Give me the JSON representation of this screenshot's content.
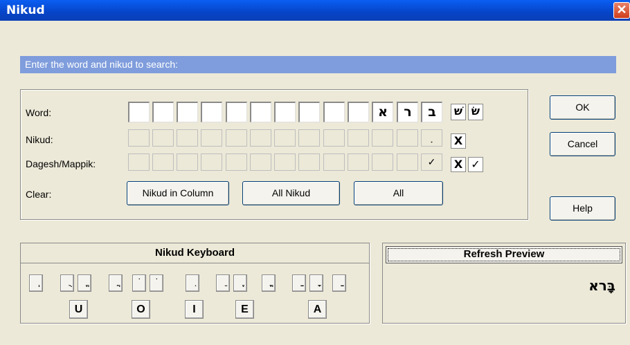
{
  "window": {
    "title": "Nikud",
    "close_glyph": "✕"
  },
  "banner": {
    "text": "Enter the word and nikud to search:"
  },
  "labels": {
    "word": "Word:",
    "nikud": "Nikud:",
    "dagesh": "Dagesh/Mappik:",
    "clear": "Clear:"
  },
  "word_letters": [
    "",
    "",
    "",
    "",
    "",
    "",
    "",
    "",
    "",
    "",
    "א",
    "ר",
    "ב"
  ],
  "nikud_marks": [
    "",
    "",
    "",
    "",
    "",
    "",
    "",
    "",
    "",
    "",
    "",
    "",
    "ָ"
  ],
  "dagesh_marks": [
    "",
    "",
    "",
    "",
    "",
    "",
    "",
    "",
    "",
    "",
    "",
    "",
    "✓"
  ],
  "side_controls": {
    "shin_right": "שׁ",
    "shin_left": "שׂ",
    "clear_nikud": "X",
    "clear_dagesh": "X",
    "dagesh_check": "✓"
  },
  "clear_buttons": {
    "nikud_in_column": "Nikud in Column",
    "all_nikud": "All Nikud",
    "all": "All"
  },
  "dialog_buttons": {
    "ok": "OK",
    "cancel": "Cancel",
    "help": "Help"
  },
  "keyboard": {
    "title": "Nikud Keyboard",
    "keys": [
      "ְ",
      "ֻ",
      "ֱ",
      "ֲ",
      "ֹ",
      "ֹ",
      "ִ",
      "ֵ",
      "ֶ",
      "ֳ",
      "ַ",
      "ָ",
      "ַ"
    ],
    "vowels": [
      "U",
      "O",
      "I",
      "E",
      "A"
    ]
  },
  "preview": {
    "button": "Refresh Preview",
    "text": "בָּרא"
  }
}
